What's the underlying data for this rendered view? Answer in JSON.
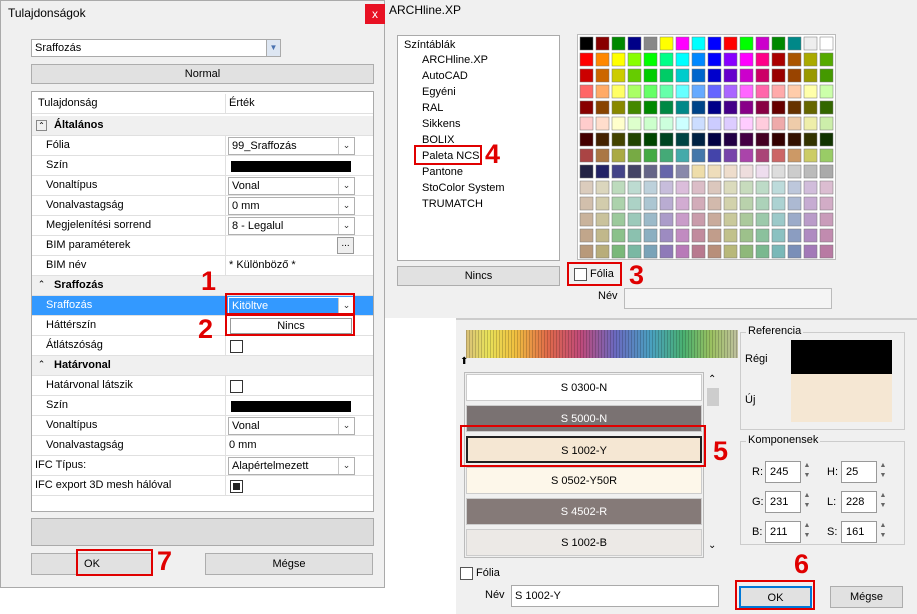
{
  "props_window": {
    "title": "Tulajdonságok",
    "close_label": "x",
    "dropdown_value": "Sraffozás",
    "filter_button": "Normal",
    "col_property": "Tulajdonság",
    "col_value": "Érték",
    "ok_label": "OK",
    "cancel_label": "Mégse",
    "sections": [
      {
        "name": "Általános"
      },
      {
        "name": "Sraffozás"
      },
      {
        "name": "Határvonal"
      }
    ],
    "rows": [
      {
        "label": "Fólia",
        "value": "99_Sraffozás"
      },
      {
        "label": "Szín",
        "value": ""
      },
      {
        "label": "Vonaltípus",
        "value": "Vonal"
      },
      {
        "label": "Vonalvastagság",
        "value": "0 mm"
      },
      {
        "label": "Megjelenítési sorrend",
        "value": "8 - Legalul"
      },
      {
        "label": "BIM paraméterek",
        "value": "..."
      },
      {
        "label": "BIM név",
        "value": "* Különböző *"
      },
      {
        "label": "Sraffozás",
        "value": "Kitöltve"
      },
      {
        "label": "Háttérszín",
        "value": "Nincs"
      },
      {
        "label": "Átlátszóság",
        "value": ""
      },
      {
        "label": "Határvonal látszik",
        "value": ""
      },
      {
        "label": "Szín",
        "value": ""
      },
      {
        "label": "Vonaltípus",
        "value": "Vonal"
      },
      {
        "label": "Vonalvastagság",
        "value": "0 mm"
      },
      {
        "label": "IFC Típus:",
        "value": "Alapértelmezett"
      },
      {
        "label": "IFC export 3D mesh hálóval",
        "value": ""
      }
    ]
  },
  "color_window": {
    "title": "ARCHline.XP",
    "tree_root": "Színtáblák",
    "tables": [
      "ARCHline.XP",
      "AutoCAD",
      "Egyéni",
      "RAL",
      "Sikkens",
      "BOLIX",
      "Paleta NCS",
      "Pantone",
      "StoColor System",
      "TRUMATCH"
    ],
    "none_button": "Nincs",
    "folia_label": "Fólia",
    "name_label": "Név",
    "palette": [
      "#000000",
      "#ff0000",
      "#00aa00",
      "#00cc66",
      "#ffff00",
      "#ff00ff",
      "#00cccc",
      "#0000ff",
      "#ffffff",
      "#ff8800",
      "#8800ff",
      "#ff0088",
      "#888888",
      "#00ff00",
      "#66ff00",
      "#0088ff"
    ]
  },
  "ncs_window": {
    "reference_label": "Referencia",
    "old_label": "Régi",
    "new_label": "Új",
    "components_label": "Komponensek",
    "old_color": "#000000",
    "new_color": "#f5e7d3",
    "items": [
      {
        "name": "S 0300-N",
        "color": "#ffffff",
        "text": "#000000"
      },
      {
        "name": "S 5000-N",
        "color": "#7a7272",
        "text": "#ffffff"
      },
      {
        "name": "S 1002-Y",
        "color": "#f5e7d3",
        "text": "#000000"
      },
      {
        "name": "S 0502-Y50R",
        "color": "#fdf7ea",
        "text": "#000000"
      },
      {
        "name": "S 4502-R",
        "color": "#857a78",
        "text": "#ffffff"
      },
      {
        "name": "S 1002-B",
        "color": "#ece9e6",
        "text": "#000000"
      }
    ],
    "r_label": "R:",
    "g_label": "G:",
    "b_label": "B:",
    "h_label": "H:",
    "l_label": "L:",
    "s_label": "S:",
    "r": "245",
    "g": "231",
    "b": "211",
    "h": "25",
    "l": "228",
    "s": "161",
    "folia_label": "Fólia",
    "name_label": "Név",
    "name_value": "S 1002-Y",
    "ok_label": "OK",
    "cancel_label": "Mégse"
  },
  "annotations": [
    "1",
    "2",
    "3",
    "4",
    "5",
    "6",
    "7"
  ]
}
